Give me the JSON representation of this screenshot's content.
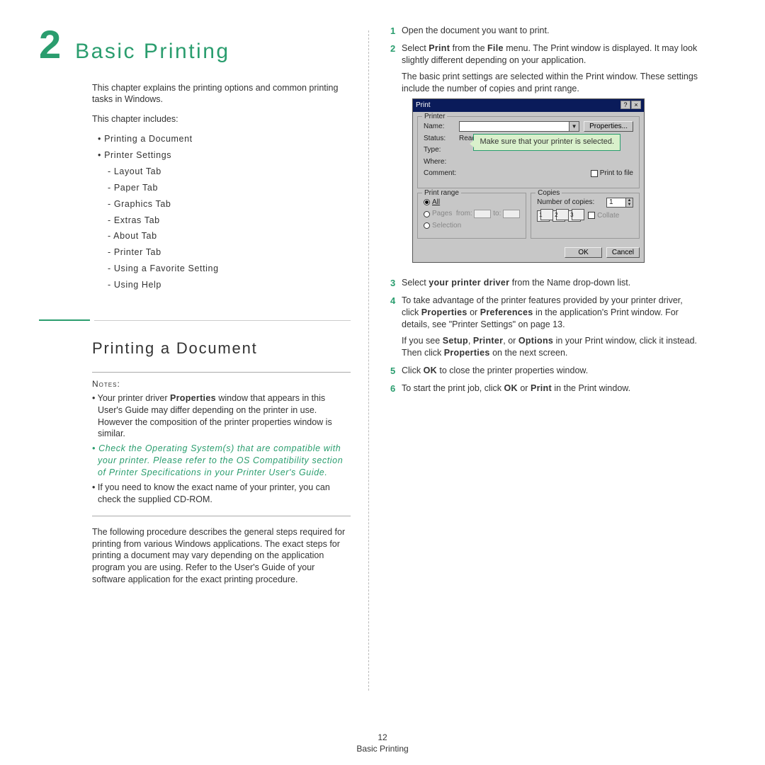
{
  "chapter": {
    "number": "2",
    "title": "Basic Printing"
  },
  "left": {
    "intro": "This chapter explains the printing options and common printing tasks in Windows.",
    "includes_label": "This chapter includes:",
    "toc": {
      "a": "Printing a Document",
      "b": "Printer Settings",
      "sub": {
        "s1": "Layout Tab",
        "s2": "Paper Tab",
        "s3": "Graphics Tab",
        "s4": "Extras Tab",
        "s5": "About Tab",
        "s6": "Printer Tab",
        "s7": "Using a Favorite Setting",
        "s8": "Using Help"
      }
    },
    "section_title": "Printing a Document",
    "notes_label": "Notes:",
    "notes": {
      "n1a": "Your printer driver ",
      "n1b": "Properties",
      "n1c": " window that appears in this User's Guide may differ depending on the printer in use. However the composition of the printer properties window is similar.",
      "n2": "Check the Operating System(s) that are compatible with your printer. Please refer to the OS Compatibility section of Printer Specifications in your Printer User's Guide.",
      "n3": "If you need to know the exact name of your printer, you can check the supplied CD-ROM."
    },
    "closing": "The following procedure describes the general steps required for printing from various Windows applications. The exact steps for printing a document may vary depending on the application program you are using. Refer to the User's Guide of your software application for the exact printing procedure."
  },
  "right": {
    "steps": {
      "s1": "Open the document you want to print.",
      "s2a": "Select ",
      "s2b": "Print",
      "s2c": " from the ",
      "s2d": "File",
      "s2e": " menu. The Print window is displayed. It may look slightly different depending on your application.",
      "s2f": "The basic print settings are selected within the Print window. These settings include the number of copies and print range.",
      "s3a": "Select ",
      "s3b": "your printer driver",
      "s3c": " from the Name drop-down list.",
      "s4a": "To take advantage of the printer features provided by your printer driver, click ",
      "s4b": "Properties",
      "s4c": " or ",
      "s4d": "Preferences",
      "s4e": " in the application's Print window. For details, see \"Printer Settings\" on page 13.",
      "s4f1": "If you see ",
      "s4f2": "Setup",
      "s4f3": ", ",
      "s4f4": "Printer",
      "s4f5": ", or ",
      "s4f6": "Options",
      "s4f7": " in your Print window, click it instead. Then click ",
      "s4f8": "Properties",
      "s4f9": " on the next screen.",
      "s5a": "Click ",
      "s5b": "OK",
      "s5c": " to close the printer properties window.",
      "s6a": "To start the print job, click ",
      "s6b": "OK",
      "s6c": " or ",
      "s6d": "Print",
      "s6e": " in the Print window."
    }
  },
  "dialog": {
    "title": "Print",
    "printer_group": "Printer",
    "name_label": "Name:",
    "properties_btn": "Properties...",
    "status_label": "Status:",
    "status_value": "Ready",
    "type_label": "Type:",
    "where_label": "Where:",
    "comment_label": "Comment:",
    "print_to_file": "Print to file",
    "range_group": "Print range",
    "all": "All",
    "pages": "Pages",
    "from": "from:",
    "to": "to:",
    "selection": "Selection",
    "copies_group": "Copies",
    "num_copies": "Number of copies:",
    "copies_value": "1",
    "collate": "Collate",
    "ok": "OK",
    "cancel": "Cancel",
    "callout": "Make sure that your printer is selected."
  },
  "footer": {
    "page_number": "12",
    "running": "Basic Printing"
  }
}
